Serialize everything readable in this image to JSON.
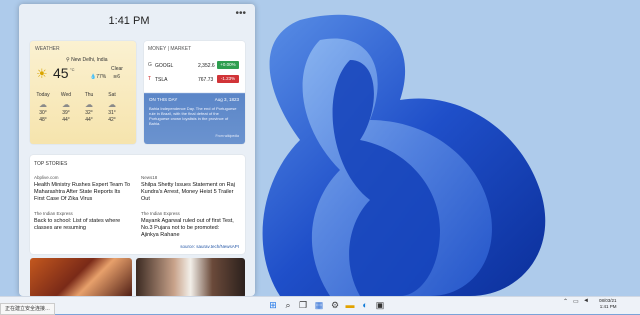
{
  "panel": {
    "time": "1:41 PM",
    "menu_icon": "more-icon"
  },
  "weather": {
    "title": "WEATHER",
    "location": "New Delhi, India",
    "temp": "45",
    "unit": "°C",
    "condition": "Clear",
    "humidity": "77%",
    "wind": "6",
    "forecast": [
      {
        "day": "Today",
        "high": "30°",
        "low": "48°"
      },
      {
        "day": "Wed",
        "high": "39°",
        "low": "44°"
      },
      {
        "day": "Thu",
        "high": "32°",
        "low": "44°"
      },
      {
        "day": "Sat",
        "high": "31°",
        "low": "42°"
      }
    ]
  },
  "money": {
    "title": "MONEY | MARKET",
    "stocks": [
      {
        "symbol": "GOOGL",
        "value": "2,352.6",
        "change": "+0.00%",
        "color": "#2e9e4f"
      },
      {
        "symbol": "TSLA",
        "value": "767.73",
        "change": "-1.23%",
        "color": "#d13438"
      }
    ],
    "on_this_day": "ON THIS DAY",
    "otd_date": "Aug 3, 1823",
    "otd_text": "Bahia Independence Day. The end of Portuguese rule in Brazil, with the final defeat of the Portuguese crown loyalists in the province of Bahia.",
    "otd_link": "From wikipedia"
  },
  "stories": {
    "title": "TOP STORIES",
    "items": [
      {
        "source": "Abplive.com",
        "headline": "Health Ministry Rushes Expert Team To Maharashtra After State Reports Its First Case Of Zika Virus"
      },
      {
        "source": "News18",
        "headline": "Shilpa Shetty Issues Statement on Raj Kundra's Arrest, Money Heist 5 Trailer Out"
      },
      {
        "source": "The Indian Express",
        "headline": "Back to school: List of states where classes are resuming"
      },
      {
        "source": "The Indian Express",
        "headline": "Mayank Agarwal ruled out of first Test, No.3 Pujara not to be promoted: Ajinkya Rahane"
      }
    ],
    "source_link": "source: saurav.tech/NewsAPI"
  },
  "taskbar": {
    "status_message": "正在建立安全连接…",
    "clock_date": "08/03/21",
    "clock_time": "1:41 PM"
  }
}
